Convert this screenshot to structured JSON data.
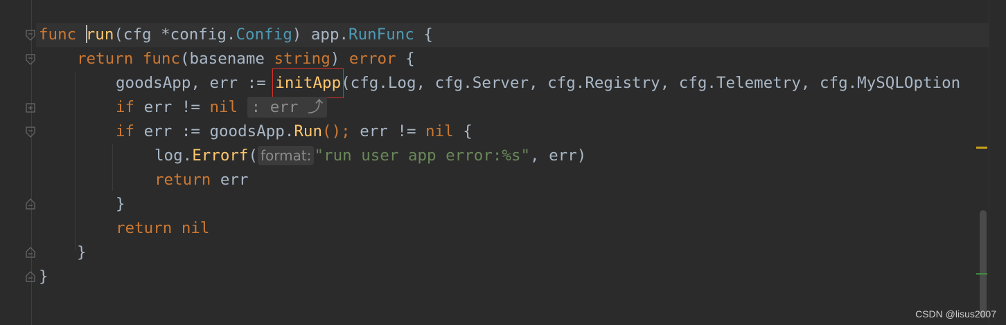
{
  "editor": {
    "lines": [
      {
        "t1": "func ",
        "t2": "run",
        "t3": "(cfg *",
        "t4": "config.",
        "t5": "Config",
        "t6": ") ",
        "t7": "app.",
        "t8": "RunFunc",
        "t9": " {"
      },
      {
        "t1": "return func",
        "t2": "(basename ",
        "t3": "string",
        "t4": ") ",
        "t5": "error",
        "t6": " {"
      },
      {
        "t1": "goodsApp, err := ",
        "t2": "initApp",
        "t3": "(cfg.Log, cfg.Server, cfg.Registry, cfg.Telemetry, cfg.MySQLOption"
      },
      {
        "t1": "if ",
        "t2": "err != ",
        "t3": "nil",
        "t4": " ",
        "hint": ": err ⤴"
      },
      {
        "t1": "if ",
        "t2": "err := goodsApp.",
        "t3": "Run",
        "t4": "(); ",
        "t5": "err != ",
        "t6": "nil",
        "t7": " {"
      },
      {
        "t1": "log.",
        "t2": "Errorf",
        "t3": "(",
        "inlay": "format:",
        "t4": "\"run user app error:%s\"",
        "t5": ", err)"
      },
      {
        "t1": "return ",
        "t2": "err"
      },
      {
        "t1": "}"
      },
      {
        "t1": "return nil"
      },
      {
        "t1": "}"
      },
      {
        "t1": "}"
      }
    ]
  },
  "watermark": "CSDN @lisus2007",
  "colors": {
    "keyword": "#cc7832",
    "function": "#ffc66d",
    "string": "#6a8759",
    "text": "#a9b7c6",
    "highlight_box": "#d8302a",
    "background": "#2b2b2b"
  },
  "icons": [
    "fold-open-icon",
    "fold-close-icon",
    "expand-plus-icon"
  ]
}
